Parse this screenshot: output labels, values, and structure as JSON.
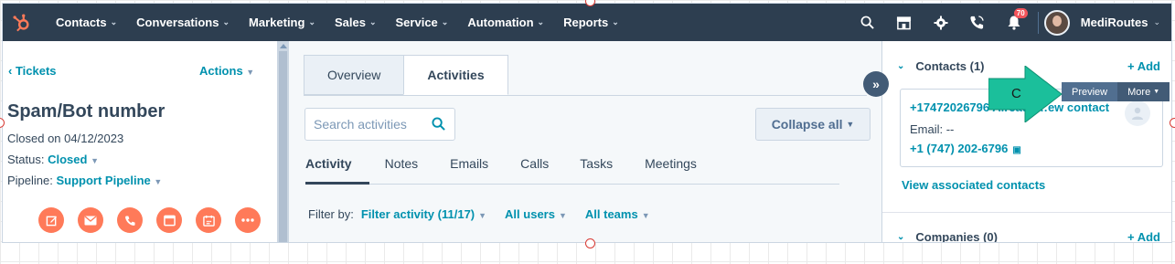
{
  "nav": {
    "items": [
      {
        "label": "Contacts"
      },
      {
        "label": "Conversations"
      },
      {
        "label": "Marketing"
      },
      {
        "label": "Sales"
      },
      {
        "label": "Service"
      },
      {
        "label": "Automation"
      },
      {
        "label": "Reports"
      }
    ],
    "notifications_count": "70",
    "account_name": "MediRoutes",
    "brand_color": "#ff7a59",
    "bar_color": "#2d3e50"
  },
  "left": {
    "breadcrumb": "‹ Tickets",
    "actions_label": "Actions",
    "title": "Spam/Bot number",
    "closed_on": "Closed on 04/12/2023",
    "status_label": "Status:",
    "status_value": "Closed",
    "pipeline_label": "Pipeline:",
    "pipeline_value": "Support Pipeline",
    "action_icons": [
      "note-icon",
      "email-icon",
      "call-icon",
      "task-icon",
      "meeting-icon",
      "more-icon"
    ]
  },
  "middle": {
    "tabs": [
      {
        "label": "Overview"
      },
      {
        "label": "Activities"
      }
    ],
    "search_placeholder": "Search activities",
    "collapse_label": "Collapse all",
    "sub_tabs": [
      {
        "label": "Activity"
      },
      {
        "label": "Notes"
      },
      {
        "label": "Emails"
      },
      {
        "label": "Calls"
      },
      {
        "label": "Tasks"
      },
      {
        "label": "Meetings"
      }
    ],
    "filter_label": "Filter by:",
    "filter_activity": "Filter activity (11/17)",
    "filter_users": "All users",
    "filter_teams": "All teams"
  },
  "right": {
    "contacts_header": "Contacts (1)",
    "add_label": "+ Add",
    "contact_phone": "+17472026796 Already…ew contact",
    "contact_email": "Email: --",
    "contact_phone2": "+1 (747) 202-6796",
    "view_associated": "View associated contacts",
    "companies_header": "Companies (0)",
    "companies_add": "+ Add",
    "preview_label": "Preview",
    "more_label": "More"
  },
  "annotation": {
    "letter": "C",
    "color": "#1bbf9b"
  }
}
